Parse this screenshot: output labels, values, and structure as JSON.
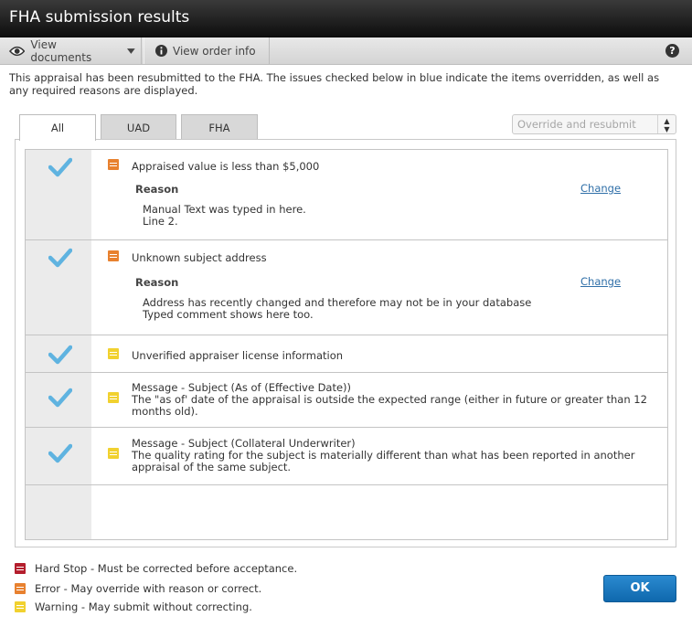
{
  "window": {
    "title": "FHA submission results"
  },
  "toolbar": {
    "view_documents": "View documents",
    "view_order_info": "View order info",
    "help": "?"
  },
  "intro": "This appraisal has been resubmitted to the FHA. The issues checked below in blue indicate the items overridden, as well as any required reasons are displayed.",
  "tabs": [
    {
      "label": "All",
      "active": true
    },
    {
      "label": "UAD",
      "active": false
    },
    {
      "label": "FHA",
      "active": false
    }
  ],
  "action_select": {
    "value": "Override and resubmit"
  },
  "issues": [
    {
      "checked": true,
      "severity": "error",
      "title": "Appraised value is less than $5,000",
      "reason_label": "Reason",
      "change_label": "Change",
      "reason_lines": [
        "Manual Text was typed in here.",
        "Line 2."
      ]
    },
    {
      "checked": true,
      "severity": "error",
      "title": "Unknown subject address",
      "reason_label": "Reason",
      "change_label": "Change",
      "reason_lines": [
        "Address has recently changed and therefore may not be in your database",
        "Typed comment shows here too."
      ]
    },
    {
      "checked": true,
      "severity": "warning",
      "title": "Unverified appraiser license information"
    },
    {
      "checked": true,
      "severity": "warning",
      "title": "Message - Subject (As of (Effective Date))",
      "description": "The \"as of' date of the appraisal is outside the expected range (either in future or greater than 12 months old)."
    },
    {
      "checked": true,
      "severity": "warning",
      "title": "Message - Subject (Collateral Underwriter)",
      "description": "The quality rating for the subject is materially different than what has been reported in another appraisal of the same subject."
    }
  ],
  "legend": {
    "hard_stop": "Hard Stop - Must be corrected before acceptance.",
    "error": "Error - May override with reason or correct.",
    "warning": "Warning - May submit without correcting."
  },
  "colors": {
    "hard_stop": "#b41e2d",
    "error": "#e8812f",
    "warning": "#f1d12f",
    "check": "#5fb3e0",
    "ok_button": "#1a78c0"
  },
  "ok_button": "OK"
}
